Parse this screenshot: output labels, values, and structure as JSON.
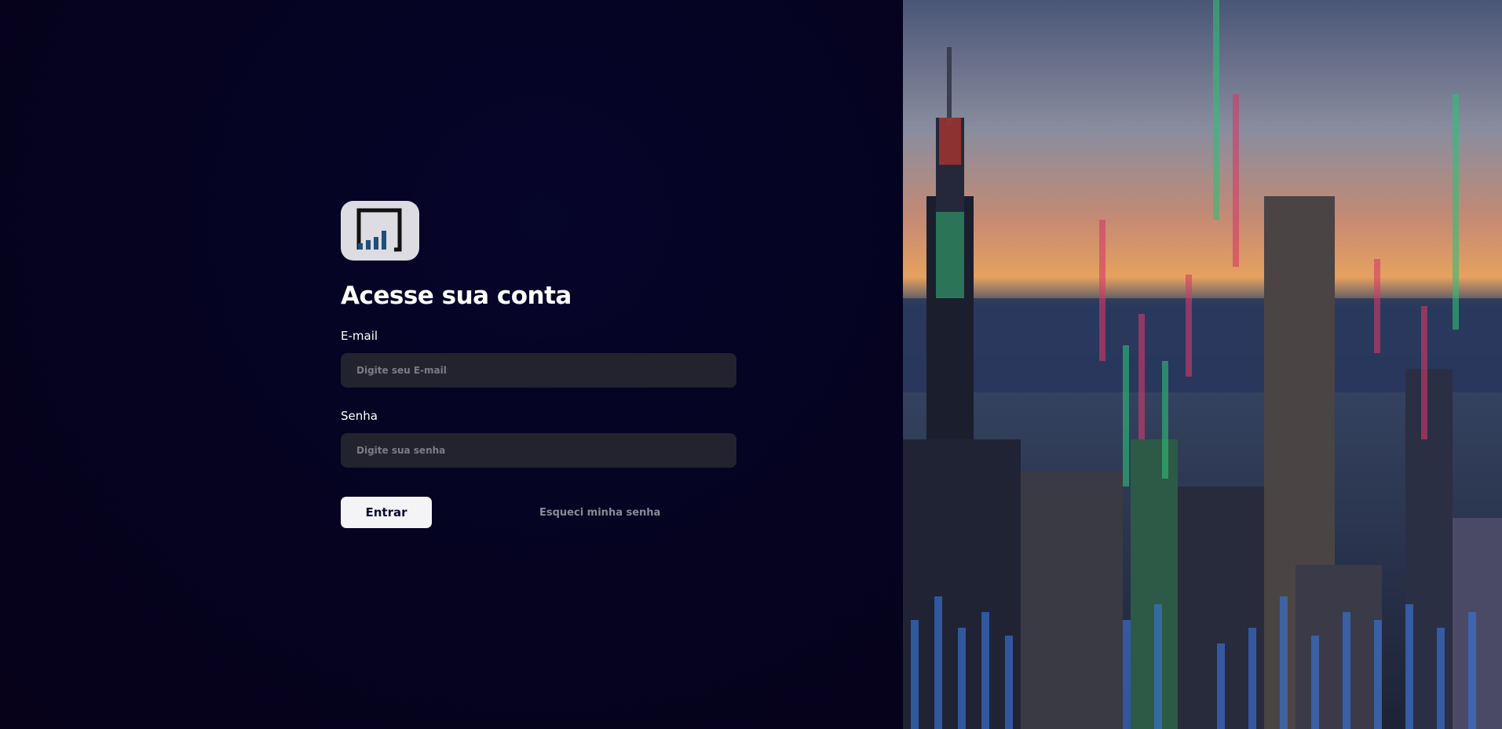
{
  "login": {
    "title": "Acesse sua conta",
    "email_label": "E-mail",
    "email_placeholder": "Digite seu E-mail",
    "password_label": "Senha",
    "password_placeholder": "Digite sua senha",
    "submit_label": "Entrar",
    "forgot_password_label": "Esqueci minha senha"
  },
  "colors": {
    "background": "#05031f",
    "input_background": "#23222f",
    "button_background": "#f4f4f7",
    "button_text": "#0b0a33",
    "link_text": "#8a8997",
    "logo_background": "#dcdce2",
    "logo_bars": "#1f4e7a"
  },
  "icons": {
    "logo": "bar-chart-frame-icon"
  },
  "hero_image": {
    "subject": "city-skyline-with-stock-chart-overlay-image"
  }
}
